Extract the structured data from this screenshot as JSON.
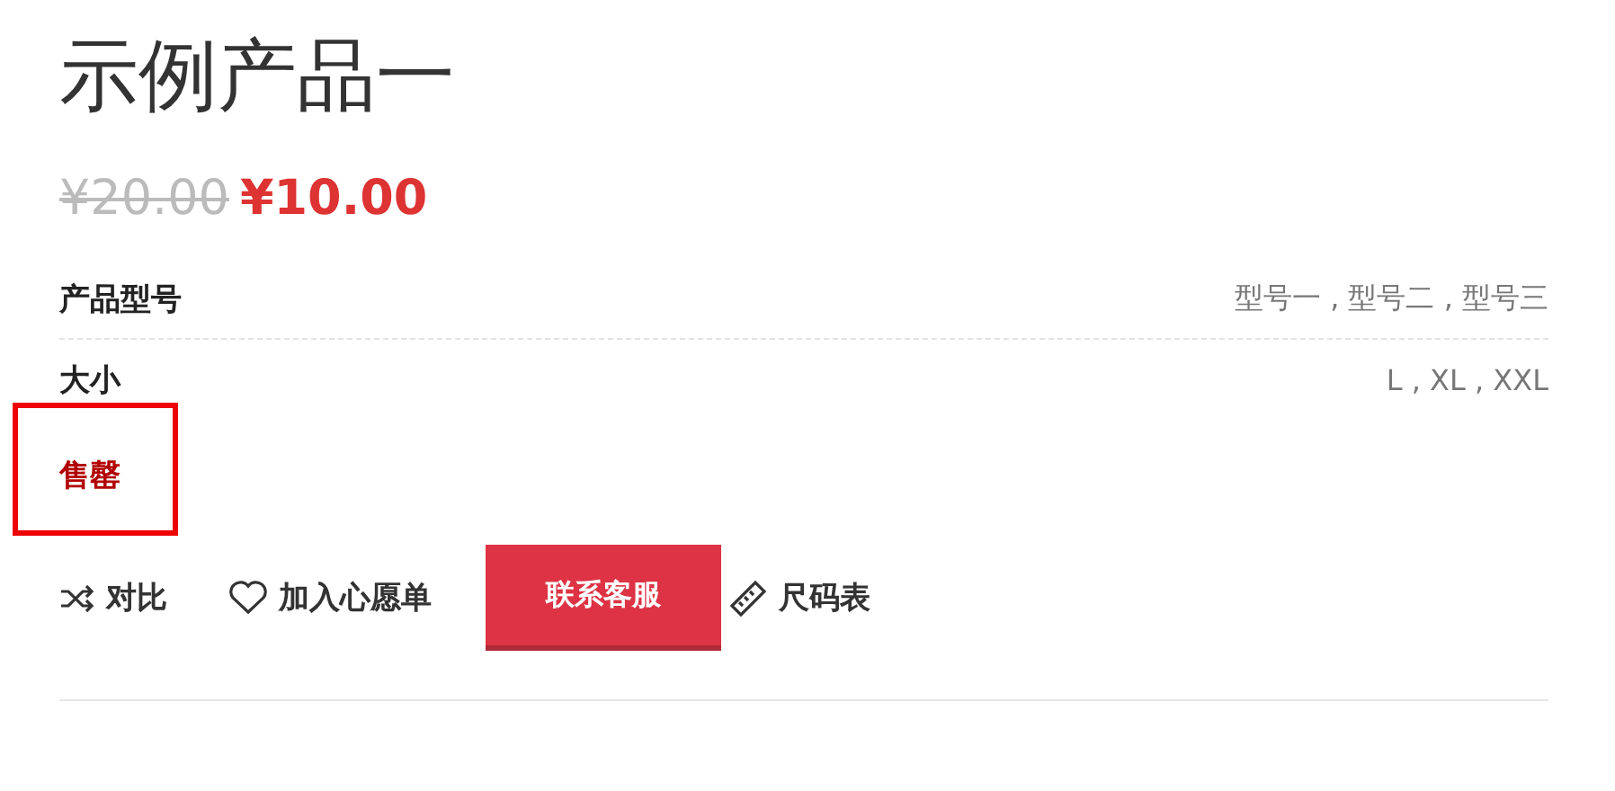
{
  "product": {
    "title": "示例产品一",
    "old_price": "¥20.00",
    "price": "¥10.00"
  },
  "attributes": [
    {
      "label": "产品型号",
      "value": "型号一 , 型号二 , 型号三"
    },
    {
      "label": "大小",
      "value": "L , XL , XXL"
    }
  ],
  "stock": {
    "text": "售罄",
    "highlighted": true
  },
  "actions": [
    {
      "kind": "compare",
      "label": "对比"
    },
    {
      "kind": "wishlist",
      "label": "加入心愿单"
    },
    {
      "kind": "button",
      "label": "联系客服"
    },
    {
      "kind": "size-guide",
      "label": "尺码表"
    }
  ]
}
